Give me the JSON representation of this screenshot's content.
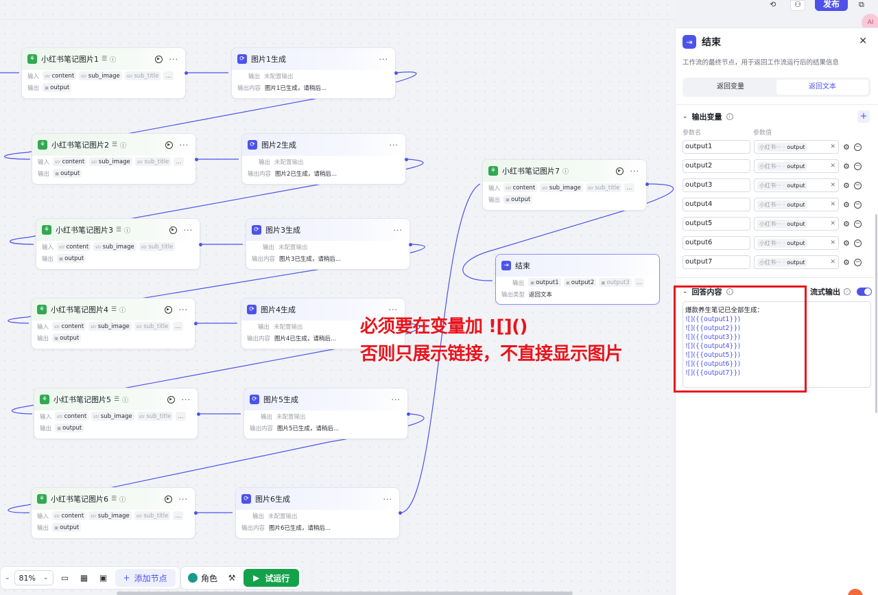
{
  "canvas": {
    "nodes": {
      "img1": {
        "title": "小红书笔记图片1"
      },
      "img2": {
        "title": "小红书笔记图片2"
      },
      "img3": {
        "title": "小红书笔记图片3"
      },
      "img4": {
        "title": "小红书笔记图片4"
      },
      "img5": {
        "title": "小红书笔记图片5"
      },
      "img6": {
        "title": "小红书笔记图片6"
      },
      "img7": {
        "title": "小红书笔记图片7"
      },
      "gen1": {
        "title": "图片1生成",
        "content": "图片1已生成，请稍后..."
      },
      "gen2": {
        "title": "图片2生成",
        "content": "图片2已生成，请稍后..."
      },
      "gen3": {
        "title": "图片3生成",
        "content": "图片3已生成，请稍后..."
      },
      "gen4": {
        "title": "图片4生成",
        "content": "图片4已生成，请稍后..."
      },
      "gen5": {
        "title": "图片5生成",
        "content": "图片5已生成，请稍后..."
      },
      "gen6": {
        "title": "图片6生成",
        "content": "图片6已生成，请稍后..."
      },
      "end": {
        "title": "结束",
        "out1": "output1",
        "out2": "output2",
        "out3": "output3",
        "type_label": "输出类型",
        "type_value": "返回文本"
      }
    },
    "labels": {
      "input": "输入",
      "output": "输出",
      "output_content": "输出内容",
      "no_output": "未配置输出",
      "str": "str",
      "content": "content",
      "sub_image": "sub_image",
      "sub_title": "sub_title",
      "output_var": "output",
      "dots": "...",
      "more": "···"
    },
    "annotation": {
      "line1": "必须要在变量加 ![]()",
      "line2": "否则只展示链接，不直接显示图片"
    }
  },
  "toolbar": {
    "zoom": "81%",
    "add_node": "添加节点",
    "role": "角色",
    "try_run": "试运行"
  },
  "header": {
    "publish": "发布",
    "fab": "AI"
  },
  "panel": {
    "title": "结束",
    "description": "工作流的最终节点，用于返回工作流运行后的结果信息",
    "tab_vars": "返回变量",
    "tab_text": "返回文本",
    "output_vars_title": "输出变量",
    "col_name": "参数名",
    "col_value": "参数值",
    "vars": [
      {
        "name": "output1",
        "source": "小红书···",
        "field": "output"
      },
      {
        "name": "output2",
        "source": "小红书···",
        "field": "output"
      },
      {
        "name": "output3",
        "source": "小红书···",
        "field": "output"
      },
      {
        "name": "output4",
        "source": "小红书···",
        "field": "output"
      },
      {
        "name": "output5",
        "source": "小红书···",
        "field": "output"
      },
      {
        "name": "output6",
        "source": "小红书···",
        "field": "output"
      },
      {
        "name": "output7",
        "source": "小红书···",
        "field": "output"
      }
    ],
    "answer_title": "回答内容",
    "stream_label": "流式输出",
    "answer_lines": {
      "intro": "爆款养生笔记已全部生成：",
      "l1": "![]({{output1}})",
      "l2": "![]({{output2}})",
      "l3": "![]({{output3}})",
      "l4": "![]({{output4}})",
      "l5": "![]({{output5}})",
      "l6": "![]({{output6}})",
      "l7": "![]({{output7}})"
    }
  },
  "colors": {
    "accent": "#4d53e8",
    "green": "#32a852",
    "annotation": "#e8141c",
    "run_button": "#13a24a"
  }
}
